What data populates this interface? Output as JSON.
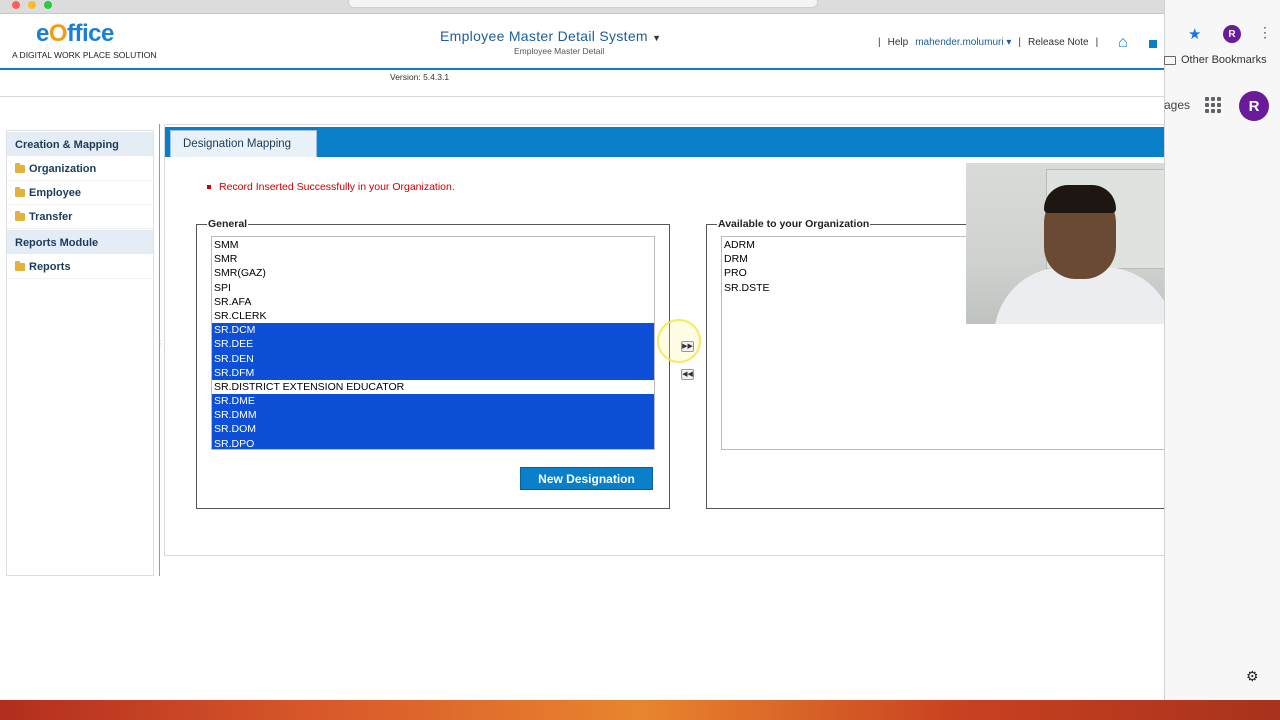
{
  "header": {
    "logo_prefix": "e",
    "logo_o": "O",
    "logo_suffix": "ffice",
    "tagline": "A DIGITAL WORK PLACE SOLUTION",
    "app_title": "Employee Master Detail System",
    "app_subtitle": "Employee Master Detail",
    "version": "Version: 5.4.3.1",
    "links": {
      "sep": "|",
      "help": "Help",
      "user": "mahender.molumuri",
      "release_note": "Release Note"
    }
  },
  "browser": {
    "other_bookmarks": "Other Bookmarks",
    "pages_fragment": "ages",
    "profile_initial": "R"
  },
  "sidebar": {
    "sections": [
      {
        "title": "Creation & Mapping"
      },
      {
        "title": "Reports Module"
      }
    ],
    "items": [
      {
        "label": "Organization"
      },
      {
        "label": "Employee"
      },
      {
        "label": "Transfer"
      },
      {
        "label": "Reports"
      }
    ]
  },
  "main": {
    "tab": "Designation Mapping",
    "message": "Record Inserted Successfully in your Organization.",
    "general": {
      "legend": "General",
      "options": [
        {
          "label": "SMM",
          "selected": false
        },
        {
          "label": "SMR",
          "selected": false
        },
        {
          "label": "SMR(GAZ)",
          "selected": false
        },
        {
          "label": "SPI",
          "selected": false
        },
        {
          "label": "SR.AFA",
          "selected": false
        },
        {
          "label": "SR.CLERK",
          "selected": false
        },
        {
          "label": "SR.DCM",
          "selected": true
        },
        {
          "label": "SR.DEE",
          "selected": true
        },
        {
          "label": "SR.DEN",
          "selected": true
        },
        {
          "label": "SR.DFM",
          "selected": true
        },
        {
          "label": "SR.DISTRICT EXTENSION EDUCATOR",
          "selected": false
        },
        {
          "label": "SR.DME",
          "selected": true
        },
        {
          "label": "SR.DMM",
          "selected": true
        },
        {
          "label": "SR.DOM",
          "selected": true
        },
        {
          "label": "SR.DPO",
          "selected": true
        }
      ]
    },
    "available": {
      "legend": "Available to your Organization",
      "options": [
        "ADRM",
        "DRM",
        "PRO",
        "SR.DSTE"
      ]
    },
    "move_right_label": "▶▶",
    "move_left_label": "◀◀",
    "new_designation_button": "New Designation"
  },
  "colors": {
    "accent": "#0a7fc9",
    "selection": "#0d4fd6",
    "message": "#cc0000"
  }
}
